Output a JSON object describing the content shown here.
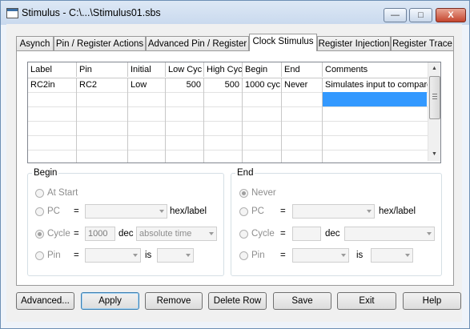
{
  "window": {
    "title": "Stimulus - C:\\...\\Stimulus01.sbs",
    "minimize": "—",
    "maximize": "□",
    "close": "X"
  },
  "tabs": [
    {
      "label": "Asynch"
    },
    {
      "label": "Pin / Register Actions"
    },
    {
      "label": "Advanced Pin / Register"
    },
    {
      "label": "Clock Stimulus"
    },
    {
      "label": "Register Injection"
    },
    {
      "label": "Register Trace"
    }
  ],
  "active_tab": "Clock Stimulus",
  "grid": {
    "columns": [
      "Label",
      "Pin",
      "Initial",
      "Low Cyc",
      "High Cyc",
      "Begin",
      "End",
      "Comments"
    ],
    "rows": [
      {
        "label": "RC2in",
        "pin": "RC2",
        "initial": "Low",
        "low": "500",
        "high": "500",
        "begin": "1000 cyc",
        "end": "Never",
        "comments": "Simulates input to compare"
      }
    ]
  },
  "begin": {
    "title": "Begin",
    "at_start": "At Start",
    "pc": "PC",
    "eq": "=",
    "hex_label": "hex/label",
    "cycle": "Cycle",
    "cycle_value": "1000",
    "dec": "dec",
    "time_mode": "absolute time",
    "pin": "Pin",
    "is": "is"
  },
  "end": {
    "title": "End",
    "never": "Never",
    "pc": "PC",
    "eq": "=",
    "hex_label": "hex/label",
    "cycle": "Cycle",
    "dec": "dec",
    "pin": "Pin",
    "is": "is"
  },
  "buttons": {
    "advanced": "Advanced...",
    "apply": "Apply",
    "remove": "Remove",
    "delete_row": "Delete Row",
    "save": "Save",
    "exit": "Exit",
    "help": "Help"
  }
}
